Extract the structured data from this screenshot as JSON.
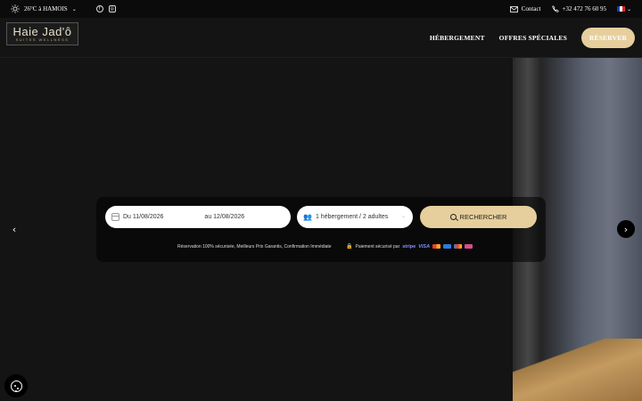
{
  "topbar": {
    "weather": "26°C à HAMOIS",
    "contact_label": "Contact",
    "phone": "+32 472 76 60 95",
    "language": "FR"
  },
  "logo": {
    "main": "Haie Jad'ô",
    "sub": "SUITES WELLNESS"
  },
  "nav": {
    "items": [
      "HÉBERGEMENT",
      "OFFRES SPÉCIALES"
    ],
    "reserve_label": "RÉSERVER"
  },
  "booking": {
    "date_from": "Du 11/08/2026",
    "date_to": "au 12/08/2026",
    "guests": "1 hébergement / 2 adultes",
    "search_label": "RECHERCHER",
    "trust": "Réservation 100% sécurisée, Meilleurs Prix Garantis, Confirmation Immédiate",
    "payment": "Paiement sécurisé par",
    "stripe": "stripe",
    "visa": "VISA"
  },
  "colors": {
    "accent": "#e6cf9c",
    "background": "#141414"
  }
}
